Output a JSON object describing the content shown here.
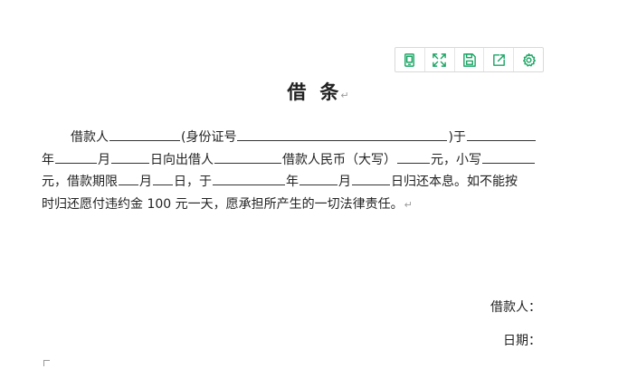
{
  "toolbar": {
    "buttons": [
      {
        "icon": "document-icon"
      },
      {
        "icon": "fullscreen-icon"
      },
      {
        "icon": "save-icon"
      },
      {
        "icon": "share-icon"
      },
      {
        "icon": "gear-icon"
      }
    ],
    "accent_color": "#1aa564"
  },
  "document": {
    "title_part1": "借",
    "title_part2": "条",
    "return_mark": "↵",
    "line1": {
      "a": "借款人",
      "b": "(身份证号",
      "c": ")于"
    },
    "line2": {
      "a": "年",
      "b": "月",
      "c": "日向出借人",
      "d": "借款人民币（大写）",
      "e": "元，小写"
    },
    "line3": {
      "a": "元，借款期限",
      "b": "月",
      "c": "日，于",
      "d": "年",
      "e": "月",
      "f": "日归还本息。如不能按"
    },
    "line4": "时归还愿付违约金 100 元一天，愿承担所产生的一切法律责任。"
  },
  "signature": {
    "borrower_label": "借款人：",
    "date_label": "日期："
  }
}
